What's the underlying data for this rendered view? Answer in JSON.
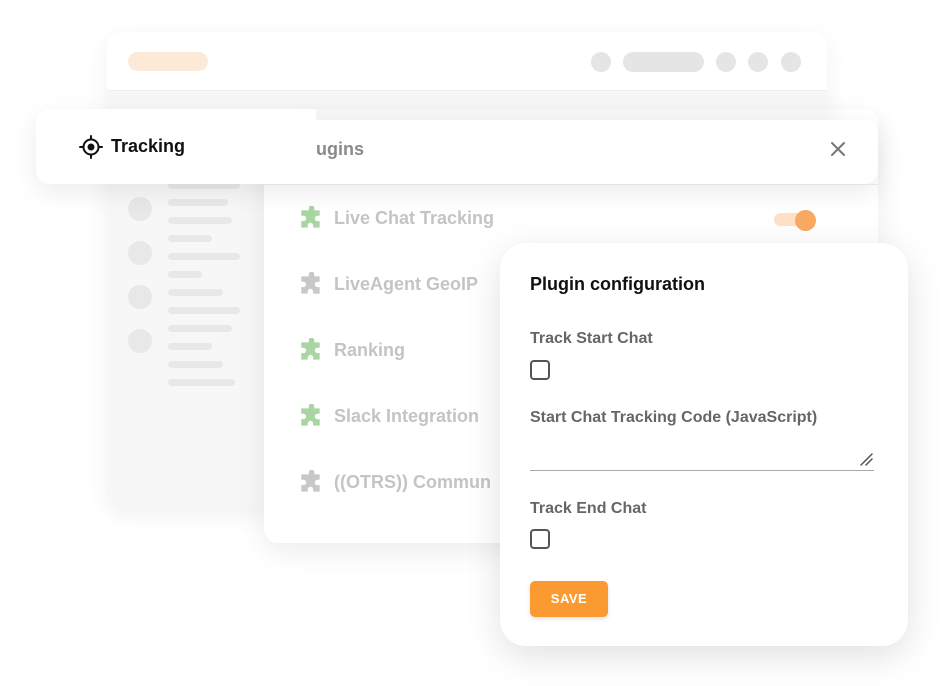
{
  "header": {
    "title": "Tracking",
    "icon": "crosshair-icon"
  },
  "plugins": {
    "title": "Plugins",
    "close_icon": "close-icon",
    "items": [
      {
        "label": "Live Chat Tracking",
        "icon": "puzzle-icon",
        "color": "#a8d5a2",
        "enabled": true
      },
      {
        "label": "LiveAgent GeoIP",
        "icon": "puzzle-icon",
        "color": "#c8c8c8"
      },
      {
        "label": "Ranking",
        "icon": "puzzle-icon",
        "color": "#a8d5a2"
      },
      {
        "label": "Slack Integration",
        "icon": "puzzle-icon",
        "color": "#a8d5a2"
      },
      {
        "label": "((OTRS)) Commun",
        "icon": "puzzle-icon",
        "color": "#c8c8c8"
      }
    ]
  },
  "config": {
    "title": "Plugin configuration",
    "track_start_label": "Track Start Chat",
    "track_start_checked": false,
    "start_code_label": "Start Chat Tracking Code (JavaScript)",
    "start_code_value": "",
    "track_end_label": "Track End Chat",
    "track_end_checked": false,
    "save_label": "SAVE"
  },
  "colors": {
    "accent": "#fb9a30",
    "toggle_on": "#f9a962",
    "puzzle_green": "#a8d5a2",
    "puzzle_gray": "#c8c8c8"
  }
}
